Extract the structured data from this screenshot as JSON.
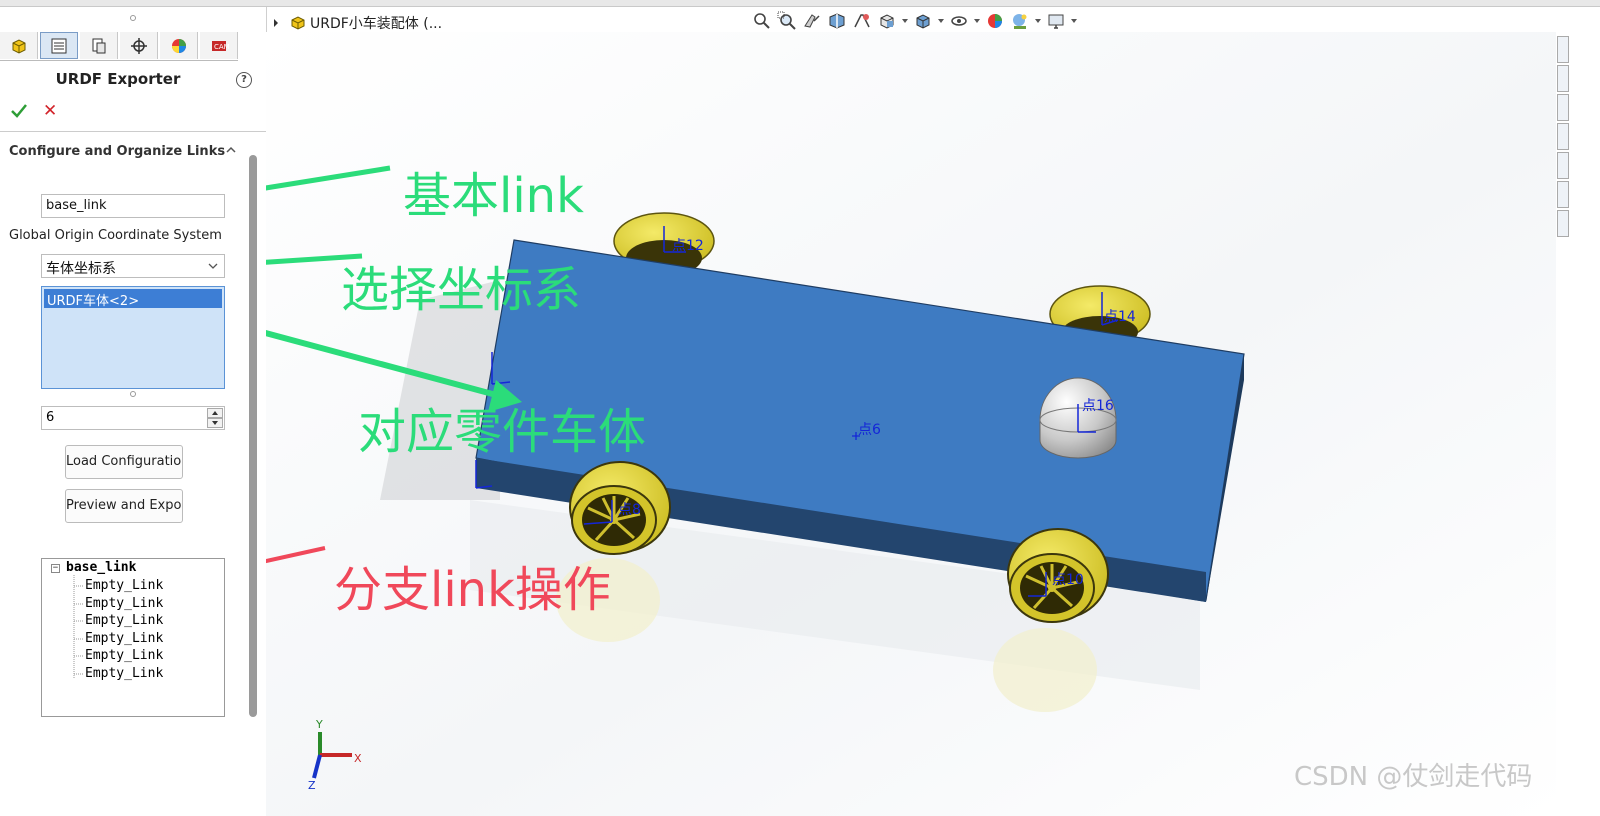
{
  "panel": {
    "title": "URDF Exporter",
    "help_glyph": "?",
    "ok_icon": "checkmark-icon",
    "cancel_glyph": "✕",
    "tabs": [
      "feature-manager-tab",
      "property-manager-tab",
      "configuration-manager-tab",
      "dim-xpert-tab",
      "display-manager-tab",
      "cam-tab"
    ],
    "section_title": "Configure and Organize Links",
    "link_name_value": "base_link",
    "origin_label": "Global Origin Coordinate System",
    "coord_system_selected": "车体坐标系",
    "selected_component": "URDF车体<2>",
    "child_count_value": "6",
    "load_button": "Load Configuration..",
    "preview_button": "Preview and Export..",
    "tree_collapse_glyph": "−",
    "tree": {
      "root": "base_link",
      "children": [
        "Empty_Link",
        "Empty_Link",
        "Empty_Link",
        "Empty_Link",
        "Empty_Link",
        "Empty_Link"
      ]
    }
  },
  "document": {
    "title": "URDF小车装配体 (..."
  },
  "viewport": {
    "points": [
      "点12",
      "点14",
      "点16",
      "点6",
      "点8",
      "点10"
    ],
    "triad_x": "X",
    "triad_y": "Y",
    "triad_z": "Z"
  },
  "annotations": {
    "base_link": "基本link",
    "coord": "选择坐标系",
    "part": "对应零件车体",
    "branch": "分支link操作"
  },
  "colors": {
    "annotation_green": "#2bdc7a",
    "annotation_red": "#f0485a",
    "car_body_top": "#3e7bc2",
    "wheel": "#e3d636"
  },
  "watermark": "CSDN @仗剑走代码"
}
